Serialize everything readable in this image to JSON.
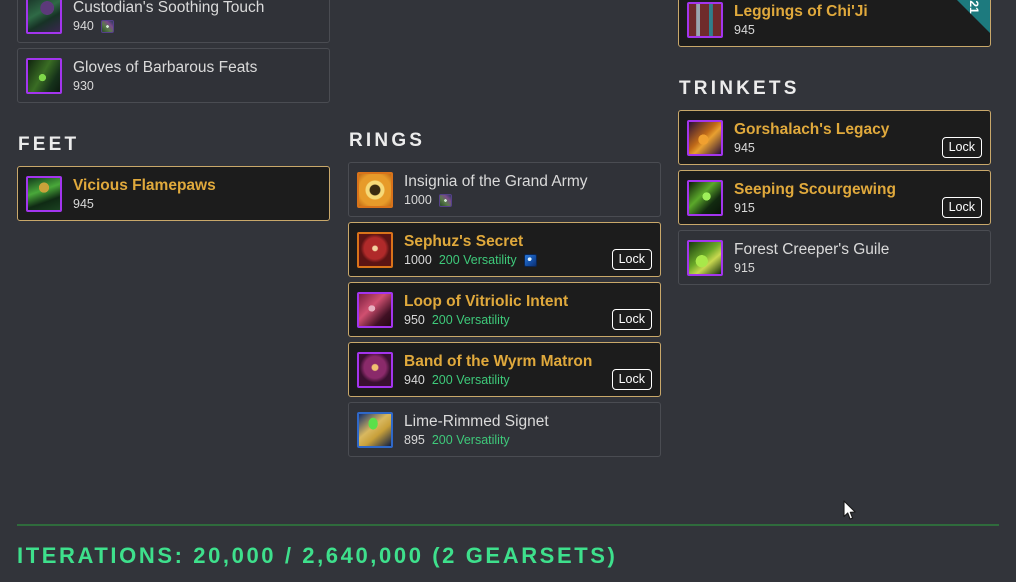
{
  "columns": [
    {
      "id": "left",
      "sections": [
        {
          "title": "",
          "items": [
            {
              "name": "Custodian's Soothing Touch",
              "ilvl": "940",
              "stat": "",
              "quality": "epic",
              "selected": false,
              "lock_label": "",
              "gems": [
                "prismatic"
              ],
              "art": "art-boots-purple",
              "ribbon": ""
            },
            {
              "name": "Gloves of Barbarous Feats",
              "ilvl": "930",
              "stat": "",
              "quality": "epic",
              "selected": false,
              "lock_label": "",
              "gems": [],
              "art": "art-gloves-green",
              "ribbon": ""
            }
          ]
        },
        {
          "title": "FEET",
          "items": [
            {
              "name": "Vicious Flamepaws",
              "ilvl": "945",
              "stat": "",
              "quality": "epic",
              "selected": true,
              "lock_label": "",
              "gems": [],
              "art": "art-flamepaws",
              "ribbon": ""
            }
          ]
        }
      ]
    },
    {
      "id": "middle",
      "sections": [
        {
          "title": "RINGS",
          "items": [
            {
              "name": "Insignia of the Grand Army",
              "ilvl": "1000",
              "stat": "",
              "quality": "legendary",
              "selected": false,
              "lock_label": "",
              "gems": [
                "prismatic"
              ],
              "art": "art-insignia",
              "ribbon": ""
            },
            {
              "name": "Sephuz's Secret",
              "ilvl": "1000",
              "stat": "200 Versatility",
              "quality": "legendary",
              "selected": true,
              "lock_label": "Lock",
              "gems": [
                "blue"
              ],
              "art": "art-sephuz",
              "ribbon": ""
            },
            {
              "name": "Loop of Vitriolic Intent",
              "ilvl": "950",
              "stat": "200 Versatility",
              "quality": "epic",
              "selected": true,
              "lock_label": "Lock",
              "gems": [],
              "art": "art-loop-vit",
              "ribbon": ""
            },
            {
              "name": "Band of the Wyrm Matron",
              "ilvl": "940",
              "stat": "200 Versatility",
              "quality": "epic",
              "selected": true,
              "lock_label": "Lock",
              "gems": [],
              "art": "art-band-wyrm",
              "ribbon": ""
            },
            {
              "name": "Lime-Rimmed Signet",
              "ilvl": "895",
              "stat": "200 Versatility",
              "quality": "rare",
              "selected": false,
              "lock_label": "",
              "gems": [],
              "art": "art-lime-signet",
              "ribbon": ""
            }
          ]
        }
      ]
    },
    {
      "id": "right",
      "sections": [
        {
          "title": "",
          "items": [
            {
              "name": "Leggings of Chi'Ji",
              "ilvl": "945",
              "stat": "",
              "quality": "epic",
              "selected": true,
              "lock_label": "",
              "gems": [],
              "art": "art-legs-red",
              "ribbon": "21"
            }
          ]
        },
        {
          "title": "TRINKETS",
          "items": [
            {
              "name": "Gorshalach's Legacy",
              "ilvl": "945",
              "stat": "",
              "quality": "epic",
              "selected": true,
              "lock_label": "Lock",
              "gems": [],
              "art": "art-gorshalach",
              "ribbon": ""
            },
            {
              "name": "Seeping Scourgewing",
              "ilvl": "915",
              "stat": "",
              "quality": "epic",
              "selected": true,
              "lock_label": "Lock",
              "gems": [],
              "art": "art-scourgewing",
              "ribbon": ""
            },
            {
              "name": "Forest Creeper's Guile",
              "ilvl": "915",
              "stat": "",
              "quality": "epic",
              "selected": false,
              "lock_label": "",
              "gems": [],
              "art": "art-forest-creeper",
              "ribbon": ""
            }
          ]
        }
      ]
    }
  ],
  "footer": {
    "iterations_label": "ITERATIONS: 20,000 / 2,640,000 (2 GEARSETS)"
  },
  "colors": {
    "page_background": "#32343a",
    "card_background": "#303238",
    "card_background_selected": "#1c1c1c",
    "card_border": "#4a4c52",
    "card_border_selected": "#c9a86a",
    "item_name_selected": "#e0a93c",
    "item_name_default": "#dadada",
    "stat_green": "#3ec97a",
    "iterations_green": "#3ee08c",
    "divider_green": "#2f6b3c",
    "ribbon_teal": "#1d7a7e",
    "quality_epic": "#a335ee",
    "quality_rare": "#2f68c8",
    "quality_legendary": "#d9731a"
  }
}
